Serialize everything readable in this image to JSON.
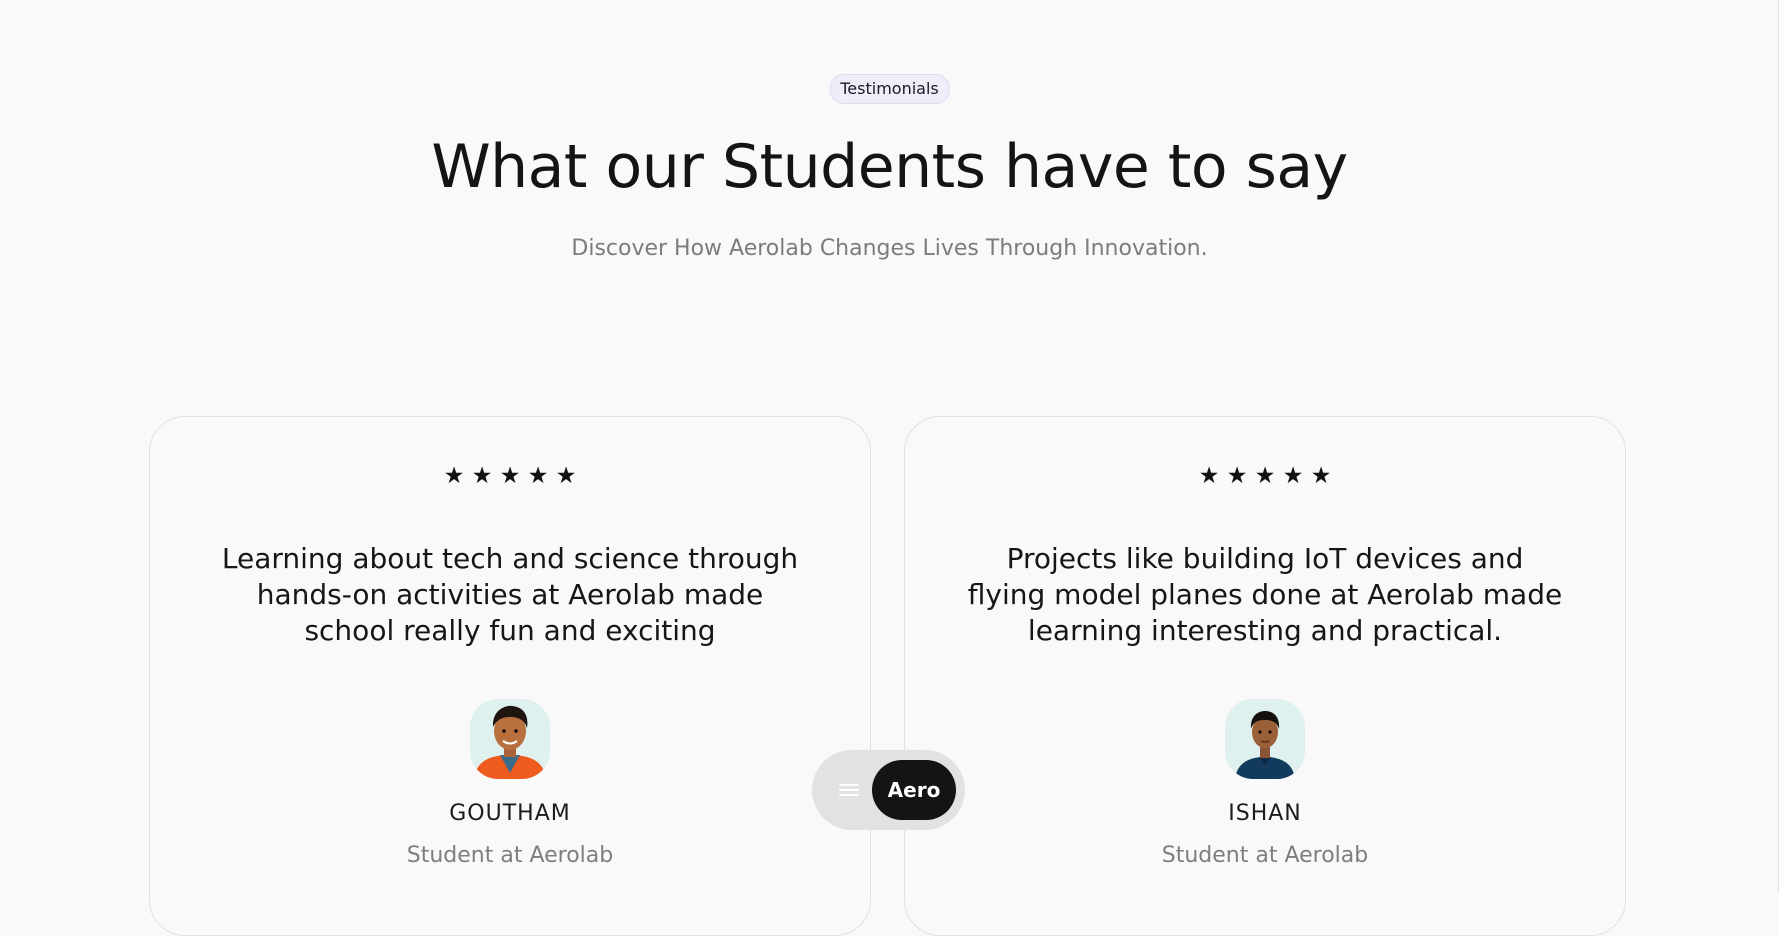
{
  "section": {
    "badge": "Testimonials",
    "title": "What our Students have to say",
    "subtitle": "Discover How Aerolab Changes Lives Through Innovation."
  },
  "testimonials": [
    {
      "rating": 5,
      "star_glyph": "★",
      "quote": "Learning about tech and science through hands-on activities at Aerolab made school really fun and exciting",
      "name": "GOUTHAM",
      "role": "Student at Aerolab",
      "avatar": "student-photo-goutham"
    },
    {
      "rating": 5,
      "star_glyph": "★",
      "quote": "Projects like building IoT devices and flying model planes done at Aerolab made learning interesting and practical.",
      "name": "ISHAN",
      "role": "Student at Aerolab",
      "avatar": "student-photo-ishan"
    }
  ],
  "nav": {
    "menu_icon": "hamburger-menu-icon",
    "brand_label": "Aero"
  },
  "colors": {
    "background": "#f9f9f9",
    "badge_bg": "#eeeef9",
    "avatar_bg": "#dff1ef",
    "nav_pill_bg": "#e2e2e2",
    "brand_button_bg": "#141414"
  }
}
